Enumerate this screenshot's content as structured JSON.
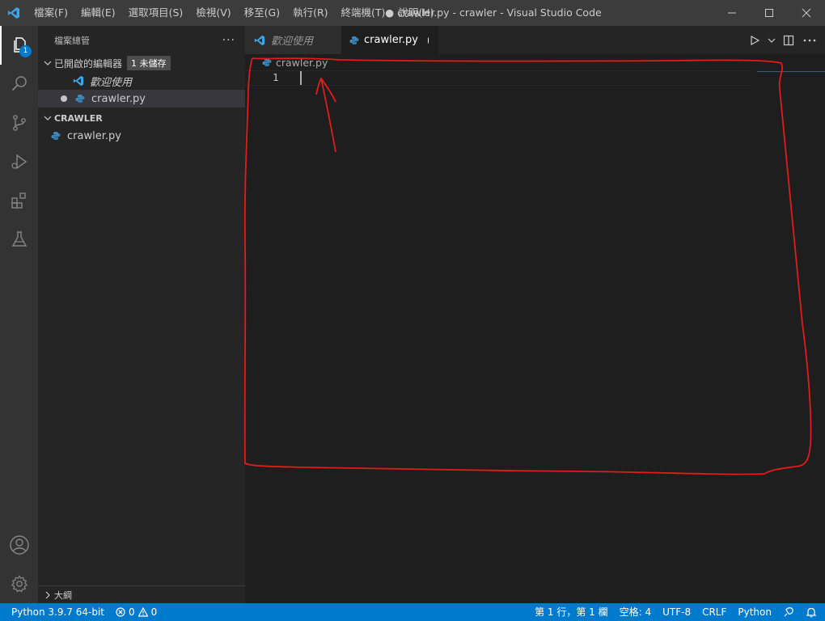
{
  "titlebar": {
    "menus": [
      "檔案(F)",
      "編輯(E)",
      "選取項目(S)",
      "檢視(V)",
      "移至(G)",
      "執行(R)",
      "終端機(T)",
      "說明(H)"
    ],
    "window_title": "● crawler.py - crawler - Visual Studio Code"
  },
  "activitybar": {
    "explorer_badge": "1"
  },
  "sidebar": {
    "title": "檔案總管",
    "more": "···",
    "open_editors": {
      "label": "已開啟的編輯器",
      "unsaved_badge": "1 未儲存",
      "items": [
        "歡迎使用",
        "crawler.py"
      ]
    },
    "folder": {
      "label": "CRAWLER",
      "items": [
        "crawler.py"
      ]
    },
    "outline": "大綱"
  },
  "editor": {
    "tabs": [
      "歡迎使用",
      "crawler.py"
    ],
    "breadcrumb": "crawler.py",
    "line_number": "1"
  },
  "statusbar": {
    "python": "Python 3.9.7 64-bit",
    "errors": "0",
    "warnings": "0",
    "position": "第 1 行，第 1 欄",
    "spaces": "空格: 4",
    "encoding": "UTF-8",
    "eol": "CRLF",
    "language": "Python"
  },
  "colors": {
    "accent": "#007acc",
    "annotation": "#e31b1b"
  }
}
